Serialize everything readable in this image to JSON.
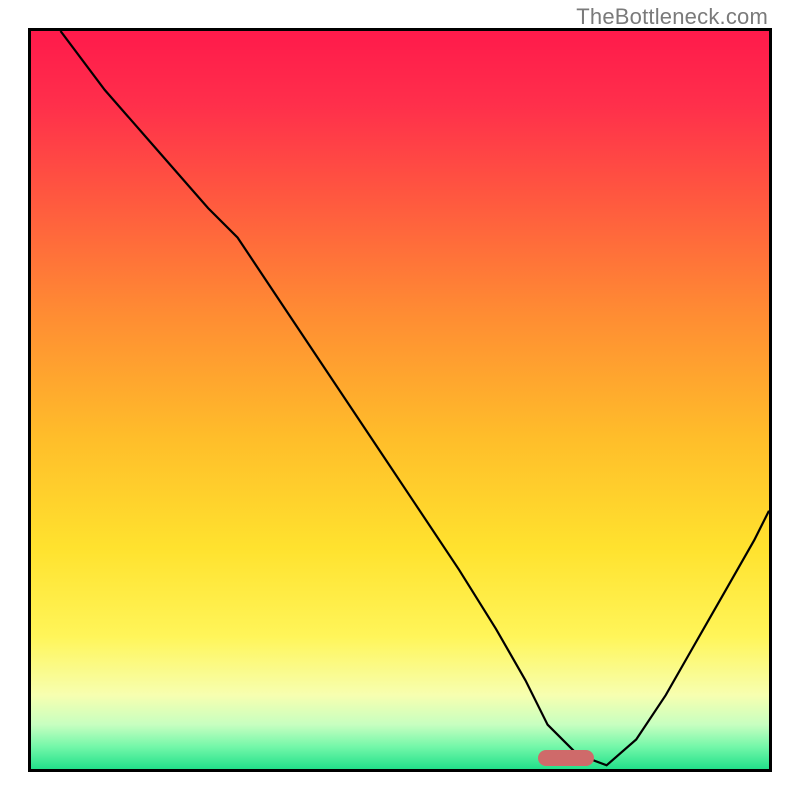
{
  "watermark": {
    "text": "TheBottleneck.com"
  },
  "gradient": {
    "stops": [
      {
        "pct": 0,
        "color": "#ff1a4b"
      },
      {
        "pct": 10,
        "color": "#ff2f4b"
      },
      {
        "pct": 22,
        "color": "#ff5640"
      },
      {
        "pct": 38,
        "color": "#ff8b33"
      },
      {
        "pct": 55,
        "color": "#ffbd2a"
      },
      {
        "pct": 70,
        "color": "#ffe22e"
      },
      {
        "pct": 82,
        "color": "#fff559"
      },
      {
        "pct": 90,
        "color": "#f7ffb0"
      },
      {
        "pct": 94,
        "color": "#c7ffc0"
      },
      {
        "pct": 97,
        "color": "#73f7a9"
      },
      {
        "pct": 100,
        "color": "#22e08a"
      }
    ]
  },
  "marker": {
    "x_pct": 72.5,
    "y_pct": 98.5,
    "color": "#cf6a6a"
  },
  "chart_data": {
    "type": "line",
    "title": "",
    "xlabel": "",
    "ylabel": "",
    "xlim": [
      0,
      100
    ],
    "ylim": [
      0,
      100
    ],
    "grid": false,
    "legend": false,
    "series": [
      {
        "name": "bottleneck-curve",
        "x": [
          4,
          10,
          17,
          24,
          28,
          34,
          40,
          46,
          52,
          58,
          63,
          67,
          70,
          74,
          78,
          82,
          86,
          90,
          94,
          98,
          100
        ],
        "y": [
          100,
          92,
          84,
          76,
          72,
          63,
          54,
          45,
          36,
          27,
          19,
          12,
          6,
          2,
          0.5,
          4,
          10,
          17,
          24,
          31,
          35
        ]
      }
    ],
    "optimal_band": {
      "x_start": 68,
      "x_end": 77
    },
    "annotations": []
  }
}
